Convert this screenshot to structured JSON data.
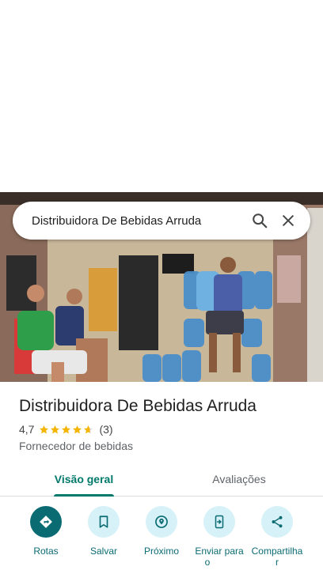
{
  "search": {
    "query": "Distribuidora De Bebidas Arruda"
  },
  "place": {
    "title": "Distribuidora De Bebidas Arruda",
    "rating": "4,7",
    "rating_value": 4.7,
    "review_count": "(3)",
    "category": "Fornecedor de bebidas",
    "star_color": "#f4b400"
  },
  "tabs": [
    {
      "label": "Visão geral",
      "active": true
    },
    {
      "label": "Avaliações",
      "active": false
    }
  ],
  "actions": [
    {
      "label": "Rotas",
      "icon": "directions-icon"
    },
    {
      "label": "Salvar",
      "icon": "bookmark-icon"
    },
    {
      "label": "Próximo",
      "icon": "nearby-icon"
    },
    {
      "label": "Enviar para o         ",
      "icon": "send-to-phone-icon"
    },
    {
      "label": "Compartilha r",
      "icon": "share-icon"
    }
  ],
  "colors": {
    "accent": "#00796b",
    "action_primary": "#0b6b73",
    "action_bg": "#d6f1f7"
  }
}
